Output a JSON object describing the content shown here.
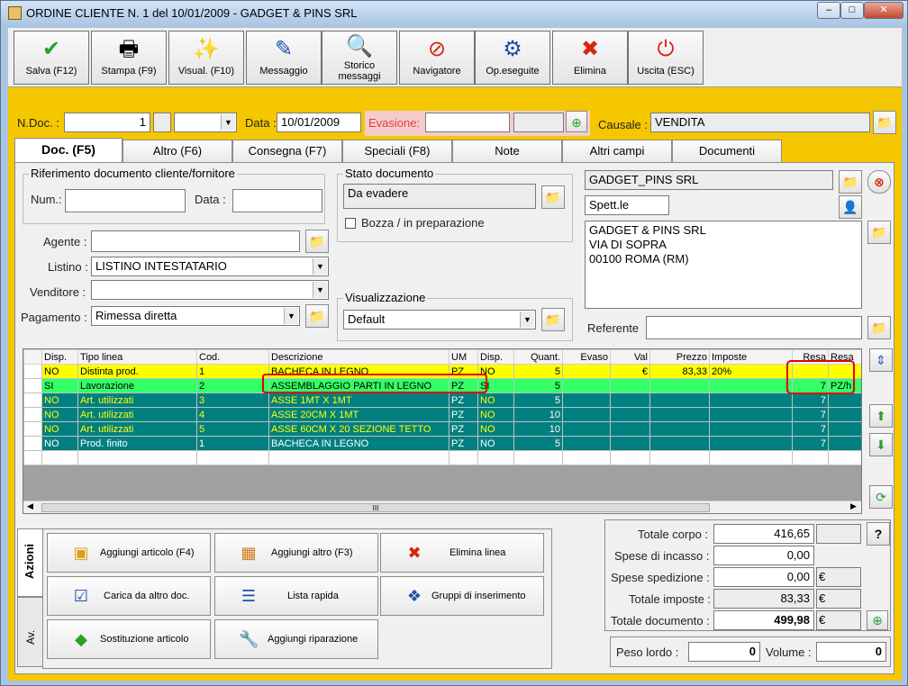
{
  "window": {
    "title": "ORDINE CLIENTE N. 1  del 10/01/2009 - GADGET & PINS SRL",
    "min": "–",
    "max": "□",
    "close": "✕"
  },
  "toolbar": [
    {
      "name": "save-button",
      "icon": "check-icon",
      "label": "Salva (F12)"
    },
    {
      "name": "print-button",
      "icon": "printer-icon",
      "label": "Stampa (F9)"
    },
    {
      "name": "preview-button",
      "icon": "wand-icon",
      "label": "Visual. (F10)"
    },
    {
      "name": "message-button",
      "icon": "pen-icon",
      "label": "Messaggio"
    },
    {
      "name": "history-button",
      "icon": "magnifier-icon",
      "label": "Storico messaggi"
    },
    {
      "name": "navigator-button",
      "icon": "compass-icon",
      "label": "Navigatore"
    },
    {
      "name": "operations-button",
      "icon": "gears-icon",
      "label": "Op.eseguite"
    },
    {
      "name": "delete-button",
      "icon": "x-icon",
      "label": "Elimina"
    },
    {
      "name": "exit-button",
      "icon": "power-icon",
      "label": "Uscita (ESC)"
    }
  ],
  "header": {
    "ndoc_label": "N.Doc. :",
    "ndoc_value": "1",
    "data_label": "Data :",
    "data_value": "10/01/2009",
    "evasione_label": "Evasione:",
    "causale_label": "Causale :",
    "causale_value": "VENDITA"
  },
  "tabs": [
    "Doc. (F5)",
    "Altro (F6)",
    "Consegna (F7)",
    "Speciali (F8)",
    "Note",
    "Altri campi",
    "Documenti"
  ],
  "riferimento": {
    "title": "Riferimento documento cliente/fornitore",
    "num_label": "Num.:",
    "data_label": "Data :"
  },
  "stato": {
    "title": "Stato documento",
    "value": "Da evadere",
    "bozza_label": "Bozza / in preparazione"
  },
  "fields": {
    "agente_label": "Agente :",
    "listino_label": "Listino :",
    "listino_value": "LISTINO INTESTATARIO",
    "venditore_label": "Venditore :",
    "pagamento_label": "Pagamento :",
    "pagamento_value": "Rimessa diretta",
    "visual_title": "Visualizzazione",
    "visual_value": "Default"
  },
  "customer": {
    "name": "GADGET_PINS SRL",
    "title": "Spett.le",
    "address_lines": [
      "GADGET & PINS SRL",
      "VIA DI SOPRA",
      "00100 ROMA (RM)"
    ],
    "referente_label": "Referente"
  },
  "grid": {
    "headers": [
      "Disp.",
      "Tipo linea",
      "Cod.",
      "Descrizione",
      "UM",
      "Disp.",
      "Quant.",
      "Evaso",
      "Val",
      "Prezzo",
      "Imposte",
      "Resa",
      "Resa"
    ],
    "rows": [
      {
        "style": "y",
        "cells": [
          "NO",
          "Distinta prod.",
          "1",
          "BACHECA IN LEGNO",
          "PZ",
          "NO",
          "5",
          "",
          "€",
          "83,33",
          "20%",
          "",
          ""
        ]
      },
      {
        "style": "g",
        "cells": [
          "SI",
          "Lavorazione",
          "2",
          "ASSEMBLAGGIO PARTI IN LEGNO",
          "PZ",
          "SI",
          "5",
          "",
          "",
          "",
          "",
          "7",
          "PZ/h"
        ]
      },
      {
        "style": "t",
        "cells": [
          "NO",
          "Art. utilizzati",
          "3",
          "ASSE 1MT X 1MT",
          "PZ",
          "NO",
          "5",
          "",
          "",
          "",
          "",
          "7",
          ""
        ]
      },
      {
        "style": "t",
        "cells": [
          "NO",
          "Art. utilizzati",
          "4",
          "ASSE 20CM X 1MT",
          "PZ",
          "NO",
          "10",
          "",
          "",
          "",
          "",
          "7",
          ""
        ]
      },
      {
        "style": "t",
        "cells": [
          "NO",
          "Art. utilizzati",
          "5",
          "ASSE 60CM X 20 SEZIONE TETTO",
          "PZ",
          "NO",
          "10",
          "",
          "",
          "",
          "",
          "7",
          ""
        ]
      },
      {
        "style": "t2",
        "cells": [
          "NO",
          "Prod. finito",
          "1",
          "BACHECA IN LEGNO",
          "PZ",
          "NO",
          "5",
          "",
          "",
          "",
          "",
          "7",
          ""
        ]
      }
    ],
    "scroll_grip": "III"
  },
  "actions": {
    "side_tab1": "Azioni",
    "side_tab2": "Av.",
    "buttons": [
      {
        "name": "add-article-button",
        "icon": "box-add-icon",
        "label": "Aggiungi articolo (F4)"
      },
      {
        "name": "add-other-button",
        "icon": "grid-add-icon",
        "label": "Aggiungi altro (F3)"
      },
      {
        "name": "delete-line-button",
        "icon": "x-icon",
        "label": "Elimina linea"
      },
      {
        "name": "load-from-doc-button",
        "icon": "checklist-icon",
        "label": "Carica da altro doc."
      },
      {
        "name": "quick-list-button",
        "icon": "list-icon",
        "label": "Lista rapida"
      },
      {
        "name": "insert-groups-button",
        "icon": "group-icon",
        "label": "Gruppi di inserimento"
      },
      {
        "name": "replace-article-button",
        "icon": "shapes-icon",
        "label": "Sostituzione articolo"
      },
      {
        "name": "add-repair-button",
        "icon": "wrench-icon",
        "label": "Aggiungi riparazione"
      }
    ]
  },
  "totals": {
    "corpo_label": "Totale corpo :",
    "corpo_value": "416,65",
    "help": "?",
    "incasso_label": "Spese di incasso :",
    "incasso_value": "0,00",
    "spedizione_label": "Spese spedizione :",
    "spedizione_value": "0,00",
    "imposte_label": "Totale imposte :",
    "imposte_value": "83,33",
    "documento_label": "Totale documento :",
    "documento_value": "499,98",
    "currency": "€",
    "peso_label": "Peso lordo :",
    "peso_value": "0",
    "volume_label": "Volume :",
    "volume_value": "0"
  },
  "colors": {
    "app_bg": "#f5c700",
    "row_yellow": "#ffff00",
    "row_green": "#33ff66",
    "row_teal": "#008080",
    "highlight": "#e00000"
  }
}
